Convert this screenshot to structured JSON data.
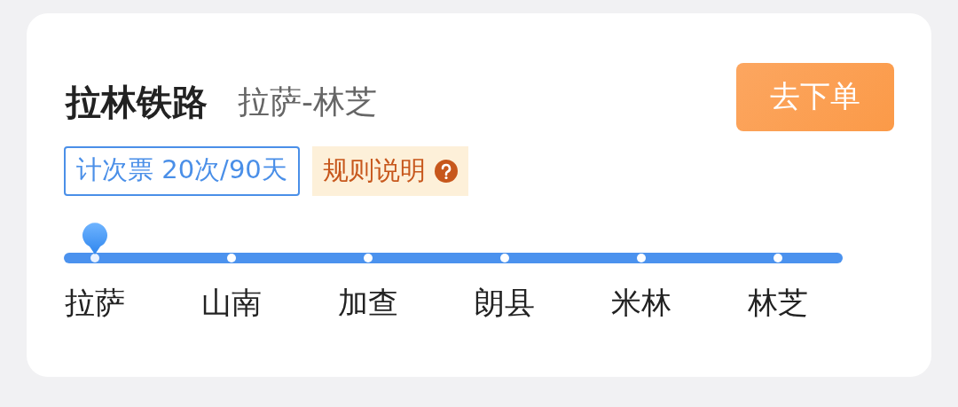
{
  "title": "拉林铁路",
  "route": "拉萨-林芝",
  "order_button": "去下单",
  "ticket_tag": "计次票 20次/90天",
  "rules_link": "规则说明",
  "stations": [
    {
      "name": "拉萨",
      "selected": true
    },
    {
      "name": "山南",
      "selected": false
    },
    {
      "name": "加查",
      "selected": false
    },
    {
      "name": "朗县",
      "selected": false
    },
    {
      "name": "米林",
      "selected": false
    },
    {
      "name": "林芝",
      "selected": false
    }
  ]
}
